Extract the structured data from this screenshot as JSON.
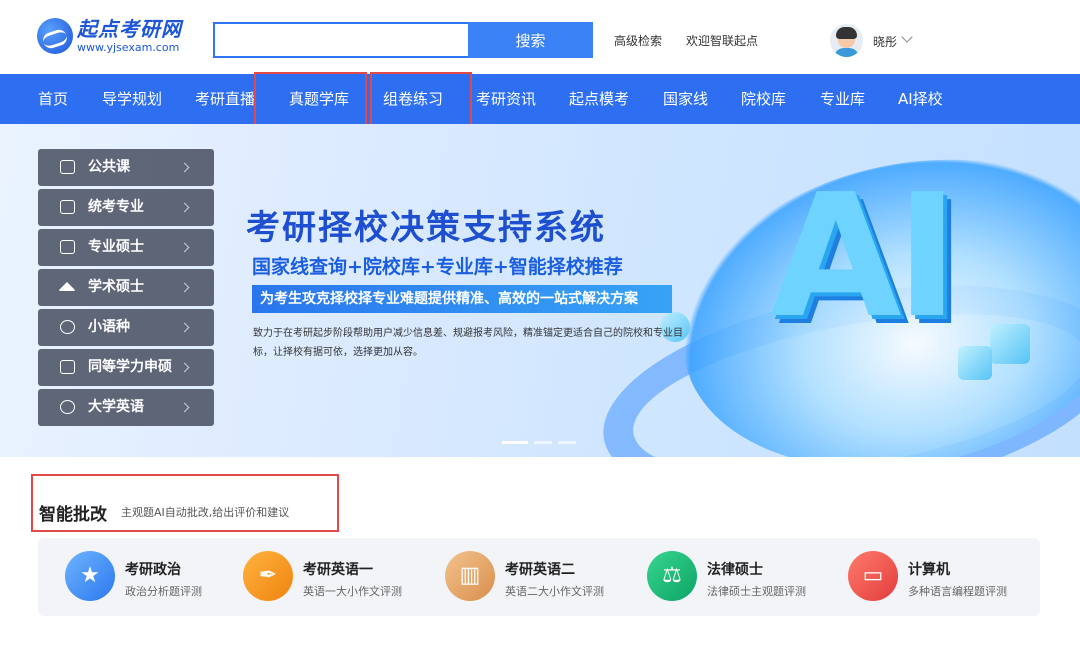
{
  "header": {
    "logo_text": "起点考研网",
    "logo_url": "www.yjsexam.com",
    "search_placeholder": "",
    "search_button": "搜索",
    "advanced_search": "高级检索",
    "welcome": "欢迎智联起点",
    "username": "晓彤"
  },
  "nav": {
    "items": [
      "首页",
      "导学规划",
      "考研直播",
      "真题学库",
      "组卷练习",
      "考研资讯",
      "起点模考",
      "国家线",
      "院校库",
      "专业库",
      "AI择校"
    ]
  },
  "sidebar": {
    "items": [
      "公共课",
      "统考专业",
      "专业硕士",
      "学术硕士",
      "小语种",
      "同等学力申硕",
      "大学英语"
    ]
  },
  "banner": {
    "title": "考研择校决策支持系统",
    "subtitle": "国家线查询+院校库+专业库+智能择校推荐",
    "strip": "为考生攻克择校择专业难题提供精准、高效的一站式解决方案",
    "desc": "致力于在考研起步阶段帮助用户减少信息差、规避报考风险，精准锚定更适合自己的院校和专业目标，让择校有据可依，选择更加从容。",
    "ai_text": "AI"
  },
  "section": {
    "title": "智能批改",
    "subtitle": "主观题AI自动批改,给出评价和建议"
  },
  "cards": [
    {
      "title": "考研政治",
      "sub": "政治分析题评测",
      "color": "#3b8ef5"
    },
    {
      "title": "考研英语一",
      "sub": "英语一大小作文评测",
      "color": "#f5951e"
    },
    {
      "title": "考研英语二",
      "sub": "英语二大小作文评测",
      "color": "#e7a86a"
    },
    {
      "title": "法律硕士",
      "sub": "法律硕士主观题评测",
      "color": "#16b877"
    },
    {
      "title": "计算机",
      "sub": "多种语言编程题评测",
      "color": "#f0504e"
    }
  ],
  "colors": {
    "nav_bg": "#2e6ff2",
    "accent": "#3a82f6",
    "highlight_box": "#e24a4a"
  }
}
